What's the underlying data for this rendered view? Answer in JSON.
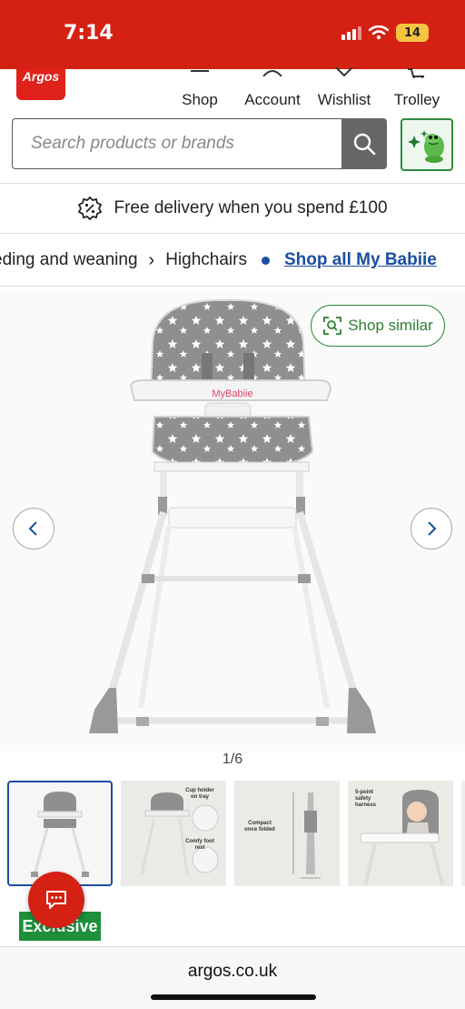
{
  "status_bar": {
    "time": "7:14",
    "battery": "14"
  },
  "header": {
    "logo": "Argos",
    "nav": [
      {
        "label": "Shop",
        "icon": "menu-icon"
      },
      {
        "label": "Account",
        "icon": "user-icon"
      },
      {
        "label": "Wishlist",
        "icon": "heart-icon"
      },
      {
        "label": "Trolley",
        "icon": "trolley-icon"
      }
    ]
  },
  "search": {
    "placeholder": "Search products or brands"
  },
  "promo": {
    "text": "Free delivery when you spend £100",
    "icon": "percent-badge-icon"
  },
  "breadcrumb": {
    "items": [
      "eding and weaning",
      "Highchairs"
    ],
    "link": "Shop all My Babiie"
  },
  "product": {
    "brand_text": "MyBabiie",
    "shop_similar": "Shop similar",
    "image_counter": "1/6",
    "thumbnails": [
      {
        "caption": ""
      },
      {
        "caption": "Cup holder on tray"
      },
      {
        "caption": "Compact once folded"
      },
      {
        "caption": "5-point safety harness"
      }
    ],
    "thumb_extra_text": "Comfy foot rest",
    "badge": "Exclusive"
  },
  "browser": {
    "url": "argos.co.uk"
  },
  "colors": {
    "brand_red": "#d42114",
    "link_blue": "#1a4fa0",
    "green": "#2e8b3c"
  }
}
